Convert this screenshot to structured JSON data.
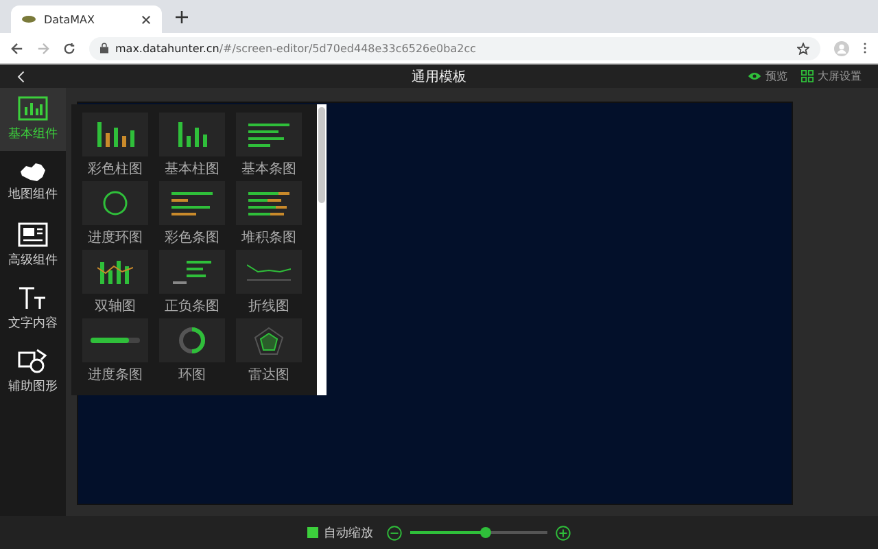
{
  "browser": {
    "tab_title": "DataMAX",
    "url_host": "max.datahunter.cn",
    "url_path": "/#/screen-editor/5d70ed448e33c6526e0ba2cc"
  },
  "header": {
    "title": "通用模板",
    "actions": [
      {
        "label": "预览",
        "kind": "eye"
      },
      {
        "label": "大屏设置",
        "kind": "grid"
      }
    ]
  },
  "sidebar": {
    "items": [
      {
        "label": "基本组件",
        "kind": "chart",
        "selected": true
      },
      {
        "label": "地图组件",
        "kind": "map",
        "selected": false
      },
      {
        "label": "高级组件",
        "kind": "layout",
        "selected": false
      },
      {
        "label": "文字内容",
        "kind": "text",
        "selected": false
      },
      {
        "label": "辅助图形",
        "kind": "shapes",
        "selected": false
      }
    ]
  },
  "panel": {
    "tiles": [
      {
        "label": "彩色柱图",
        "kind": "color-bars"
      },
      {
        "label": "基本柱图",
        "kind": "bars"
      },
      {
        "label": "基本条图",
        "kind": "hbars"
      },
      {
        "label": "进度环图",
        "kind": "progress-ring"
      },
      {
        "label": "彩色条图",
        "kind": "color-hbars"
      },
      {
        "label": "堆积条图",
        "kind": "stacked-hbars"
      },
      {
        "label": "双轴图",
        "kind": "dual-axis"
      },
      {
        "label": "正负条图",
        "kind": "pos-neg"
      },
      {
        "label": "折线图",
        "kind": "line"
      },
      {
        "label": "进度条图",
        "kind": "progress-bar"
      },
      {
        "label": "环图",
        "kind": "donut"
      },
      {
        "label": "雷达图",
        "kind": "radar"
      }
    ]
  },
  "footer": {
    "auto_zoom": {
      "label": "自动缩放",
      "checked": true
    },
    "zoom": {
      "level": 0.55
    }
  }
}
